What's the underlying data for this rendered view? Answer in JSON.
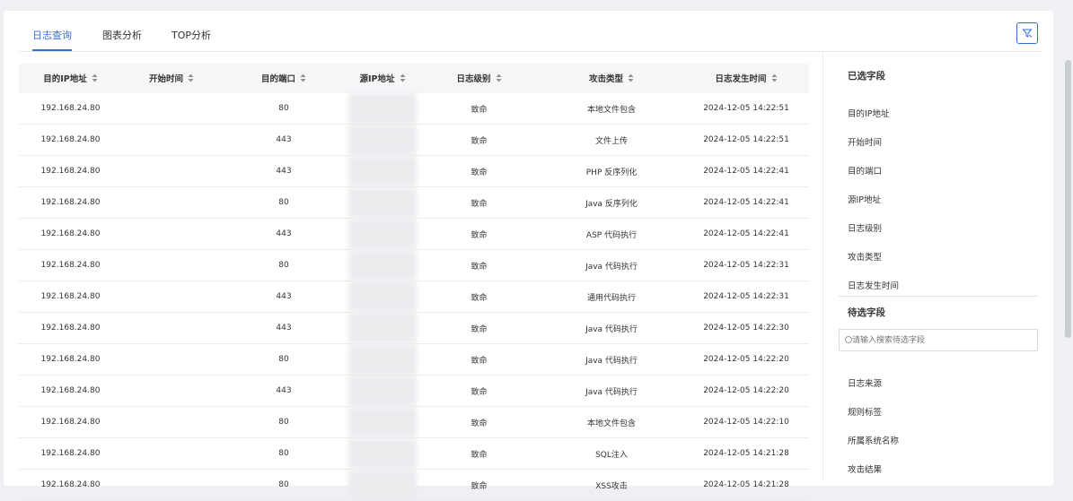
{
  "tabs": [
    {
      "label": "日志查询"
    },
    {
      "label": "图表分析"
    },
    {
      "label": "TOP分析"
    }
  ],
  "table": {
    "columns": [
      "目的IP地址",
      "开始时间",
      "目的端口",
      "源IP地址",
      "日志级别",
      "攻击类型",
      "日志发生时间"
    ],
    "rows": [
      {
        "dst_ip": "192.168.24.80",
        "start": "",
        "port": "80",
        "src_ip": "",
        "level": "致命",
        "type": "本地文件包含",
        "time": "2024-12-05 14:22:51"
      },
      {
        "dst_ip": "192.168.24.80",
        "start": "",
        "port": "443",
        "src_ip": "",
        "level": "致命",
        "type": "文件上传",
        "time": "2024-12-05 14:22:51"
      },
      {
        "dst_ip": "192.168.24.80",
        "start": "",
        "port": "443",
        "src_ip": "",
        "level": "致命",
        "type": "PHP 反序列化",
        "time": "2024-12-05 14:22:41"
      },
      {
        "dst_ip": "192.168.24.80",
        "start": "",
        "port": "80",
        "src_ip": "",
        "level": "致命",
        "type": "Java 反序列化",
        "time": "2024-12-05 14:22:41"
      },
      {
        "dst_ip": "192.168.24.80",
        "start": "",
        "port": "443",
        "src_ip": "",
        "level": "致命",
        "type": "ASP 代码执行",
        "time": "2024-12-05 14:22:41"
      },
      {
        "dst_ip": "192.168.24.80",
        "start": "",
        "port": "80",
        "src_ip": "",
        "level": "致命",
        "type": "Java 代码执行",
        "time": "2024-12-05 14:22:31"
      },
      {
        "dst_ip": "192.168.24.80",
        "start": "",
        "port": "443",
        "src_ip": "",
        "level": "致命",
        "type": "通用代码执行",
        "time": "2024-12-05 14:22:31"
      },
      {
        "dst_ip": "192.168.24.80",
        "start": "",
        "port": "443",
        "src_ip": "",
        "level": "致命",
        "type": "Java 代码执行",
        "time": "2024-12-05 14:22:30"
      },
      {
        "dst_ip": "192.168.24.80",
        "start": "",
        "port": "80",
        "src_ip": "",
        "level": "致命",
        "type": "Java 代码执行",
        "time": "2024-12-05 14:22:20"
      },
      {
        "dst_ip": "192.168.24.80",
        "start": "",
        "port": "443",
        "src_ip": "",
        "level": "致命",
        "type": "Java 代码执行",
        "time": "2024-12-05 14:22:20"
      },
      {
        "dst_ip": "192.168.24.80",
        "start": "",
        "port": "80",
        "src_ip": "",
        "level": "致命",
        "type": "本地文件包含",
        "time": "2024-12-05 14:22:10"
      },
      {
        "dst_ip": "192.168.24.80",
        "start": "",
        "port": "80",
        "src_ip": "",
        "level": "致命",
        "type": "SQL注入",
        "time": "2024-12-05 14:21:28"
      },
      {
        "dst_ip": "192.168.24.80",
        "start": "",
        "port": "80",
        "src_ip": "",
        "level": "致命",
        "type": "XSS攻击",
        "time": "2024-12-05 14:21:28"
      }
    ]
  },
  "sidebar": {
    "selected_title": "已选字段",
    "selected": [
      "目的IP地址",
      "开始时间",
      "目的端口",
      "源IP地址",
      "日志级别",
      "攻击类型",
      "日志发生时间"
    ],
    "pending_title": "待选字段",
    "search_placeholder": "请输入搜索待选字段",
    "pending": [
      "日志来源",
      "规则标签",
      "所属系统名称",
      "攻击结果"
    ]
  },
  "colors": {
    "accent": "#3a6fd8"
  }
}
